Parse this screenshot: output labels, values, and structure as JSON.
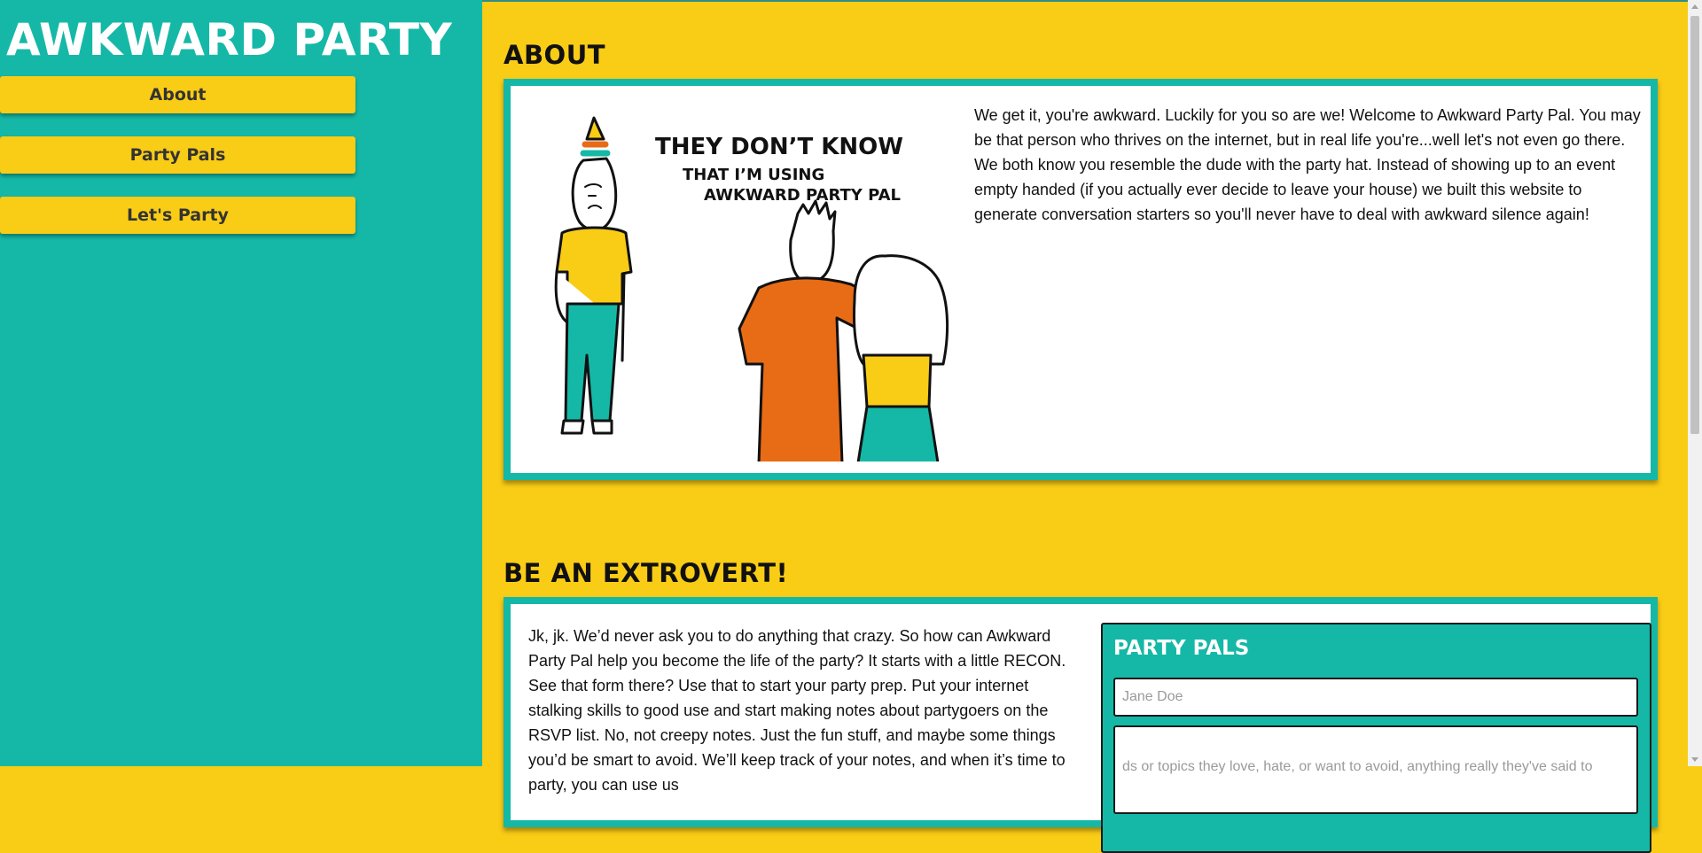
{
  "site": {
    "title": "AWKWARD PARTY PAL"
  },
  "nav": {
    "items": [
      {
        "label": "About"
      },
      {
        "label": "Party Pals"
      },
      {
        "label": "Let's Party"
      }
    ]
  },
  "about": {
    "heading": "ABOUT",
    "illustration": {
      "caption_line1": "THEY DON’T KNOW",
      "caption_line2": "THAT I’M USING",
      "caption_line3": "AWKWARD PARTY PAL"
    },
    "text": "We get it, you're awkward. Luckily for you so are we! Welcome to Awkward Party Pal. You may be that person who thrives on the internet, but in real life you're...well let's not even go there. We both know you resemble the dude with the party hat. Instead of showing up to an event empty handed (if you actually ever decide to leave your house) we built this website to generate conversation starters so you'll never have to deal with awkward silence again!"
  },
  "extrovert": {
    "heading": "BE AN EXTROVERT!",
    "text": "Jk, jk. We’d never ask you to do anything that crazy. So how can Awkward Party Pal help you become the life of the party? It starts with a little RECON. See that form there? Use that to start your party prep. Put your internet stalking skills to good use and start making notes about partygoers on the RSVP list. No, not creepy notes. Just the fun stuff, and maybe some things you’d be smart to avoid. We’ll keep track of your notes, and when it’s time to party, you can use us"
  },
  "party_pals_form": {
    "title": "PARTY PALS",
    "name_placeholder": "Jane Doe",
    "notes_placeholder": "ds or topics they love, hate, or want to avoid, anything really they've said to"
  },
  "colors": {
    "teal": "#15b8a6",
    "yellow": "#f9cc16",
    "orange": "#e86b16",
    "white": "#ffffff"
  }
}
